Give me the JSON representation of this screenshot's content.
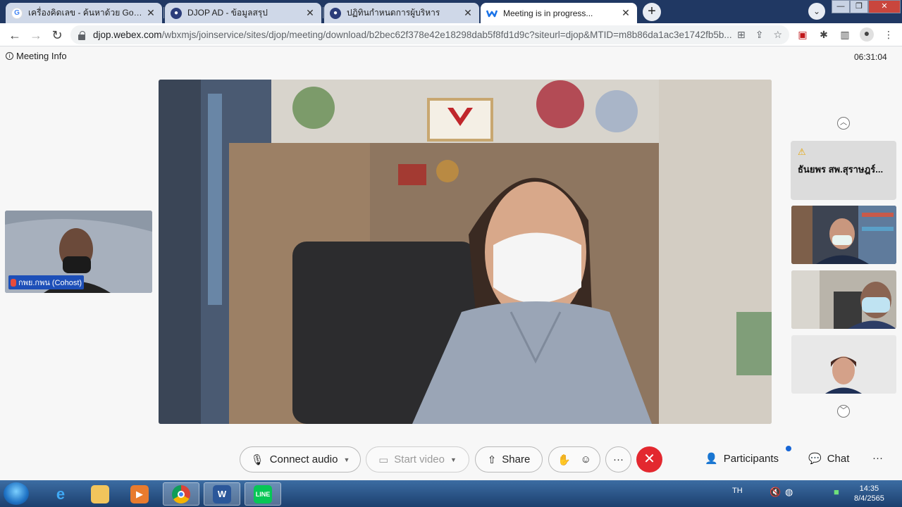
{
  "browser": {
    "tabs": [
      {
        "title": "เครื่องคิดเลข - ค้นหาด้วย Google",
        "favicon": "google-icon"
      },
      {
        "title": "DJOP AD - ข้อมูลสรุป",
        "favicon": "djop-icon"
      },
      {
        "title": "ปฏิทินกำหนดการผู้บริหาร",
        "favicon": "djop-icon"
      },
      {
        "title": "Meeting is in progress...",
        "favicon": "webex-icon"
      }
    ],
    "new_tab": "+",
    "url_host": "djop.webex.com",
    "url_path": "/wbxmjs/joinservice/sites/djop/meeting/download/b2bec62f378e42e18298dab5f8fd1d9c?siteurl=djop&MTID=m8b86da1ac3e1742fb5b..."
  },
  "webex": {
    "meeting_info_label": "Meeting Info",
    "clock": "06:31:04",
    "self_view_label": "กพย.กพน (Cohost)",
    "participant_card_name": "ธันยพร สพ.สุราษฎร์...",
    "controls": {
      "connect_audio": "Connect audio",
      "start_video": "Start video",
      "share": "Share",
      "participants": "Participants",
      "chat": "Chat",
      "more": "···",
      "overflow": "···"
    }
  },
  "taskbar": {
    "language": "TH",
    "time": "14:35",
    "date": "8/4/2565"
  },
  "colors": {
    "end_button": "#e3282f",
    "tab_strip": "#203863",
    "notification_dot": "#1766d6"
  }
}
